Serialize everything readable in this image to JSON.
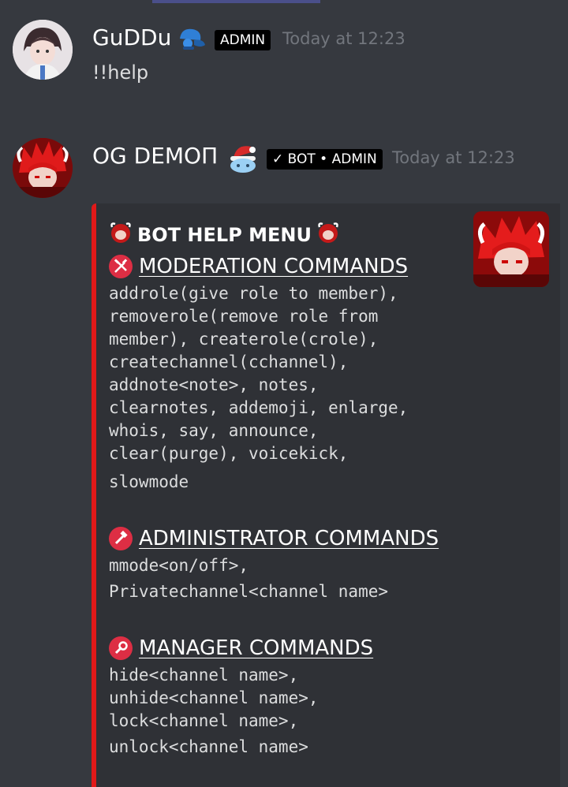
{
  "messages": [
    {
      "author": "GuDDu",
      "badge": "ADMIN",
      "timestamp": "Today at 12:23",
      "text": "!!help",
      "name_emoji": "blue-cap-emoji"
    },
    {
      "author": "OG DEMOП",
      "badge": "✓ BOT • ADMIN",
      "timestamp": "Today at 12:23",
      "name_emoji": "santa-hat-emoji"
    }
  ],
  "embed": {
    "title": "BOT  HELP MENU",
    "sections": [
      {
        "icon": "hammer-pick-icon",
        "heading": "MODERATION COMMANDS",
        "lines": [
          "addrole(give role to member),",
          "removerole(remove role from",
          "member), createrole(crole),",
          "createchannel(cchannel),",
          "addnote<note>, notes,",
          "clearnotes, addemoji, enlarge,",
          "whois, say, announce,",
          "clear(purge), voicekick,",
          "slowmode"
        ]
      },
      {
        "icon": "hammer-icon",
        "heading": "ADMINISTRATOR COMMANDS",
        "lines": [
          "mmode<on/off>,",
          "Privatechannel<channel name>"
        ]
      },
      {
        "icon": "wrench-icon",
        "heading": "MANAGER COMMANDS",
        "lines": [
          "hide<channel name>,",
          "unhide<channel name>,",
          "lock<channel name>,",
          "unlock<channel name>"
        ]
      }
    ]
  },
  "colors": {
    "background": "#36393f",
    "embed_background": "#2f3136",
    "embed_accent": "#e11919",
    "timestamp": "#72767d"
  }
}
